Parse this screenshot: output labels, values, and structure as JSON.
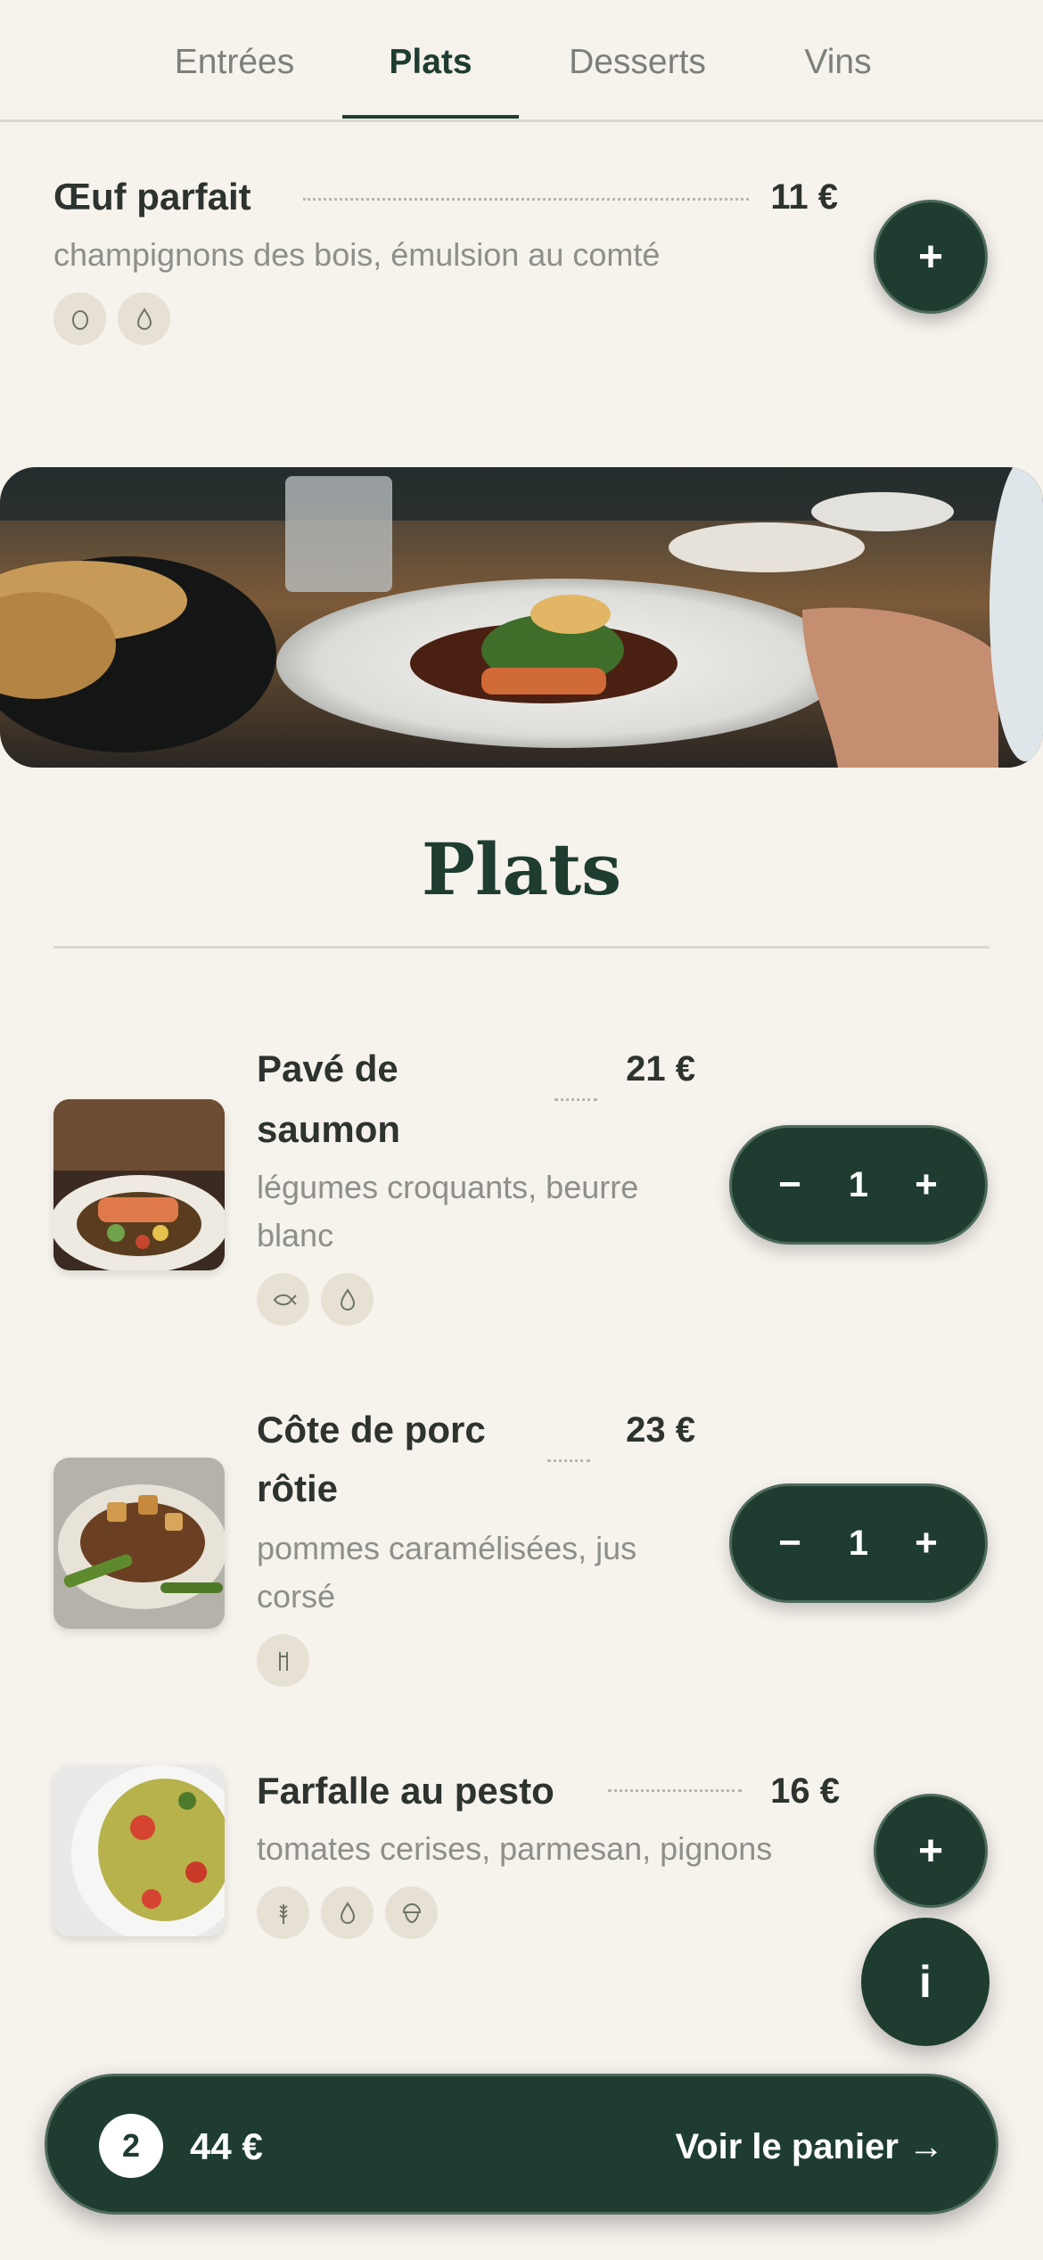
{
  "tabs": [
    {
      "label": "Entrées"
    },
    {
      "label": "Plats"
    },
    {
      "label": "Desserts"
    },
    {
      "label": "Vins"
    }
  ],
  "active_tab": "Plats",
  "featured_dish": {
    "name": "Œuf parfait",
    "price": "11 €",
    "description": "champignons des bois, émulsion au comté",
    "tags": [
      "egg-icon",
      "drop-icon"
    ],
    "add_label": "+"
  },
  "section": {
    "title": "Plats"
  },
  "dishes": [
    {
      "name_line1": "Pavé de",
      "name_line2": "saumon",
      "price": "21 €",
      "desc_line1": "légumes croquants, beurre",
      "desc_line2": "blanc",
      "tags": [
        "fish-icon",
        "drop-icon"
      ],
      "quantity": "1",
      "minus": "−",
      "plus": "+"
    },
    {
      "name_line1": "Côte de porc",
      "name_line2": "rôtie",
      "price": "23 €",
      "desc_line1": "pommes caramélisées, jus",
      "desc_line2": "corsé",
      "tags": [
        "meat-icon"
      ],
      "quantity": "1",
      "minus": "−",
      "plus": "+"
    },
    {
      "name": "Farfalle au pesto",
      "price": "16 €",
      "description": "tomates cerises, parmesan, pignons",
      "tags": [
        "wheat-icon",
        "drop-icon",
        "nut-icon"
      ],
      "add_label": "+"
    }
  ],
  "info_button": {
    "label": "i"
  },
  "cart": {
    "count": "2",
    "total": "44 €",
    "cta": "Voir le panier →"
  },
  "colors": {
    "background": "#f6f2ec",
    "accent": "#1e3d30",
    "tag_bg": "#e6e1d4",
    "muted_text": "#8d8f89"
  }
}
